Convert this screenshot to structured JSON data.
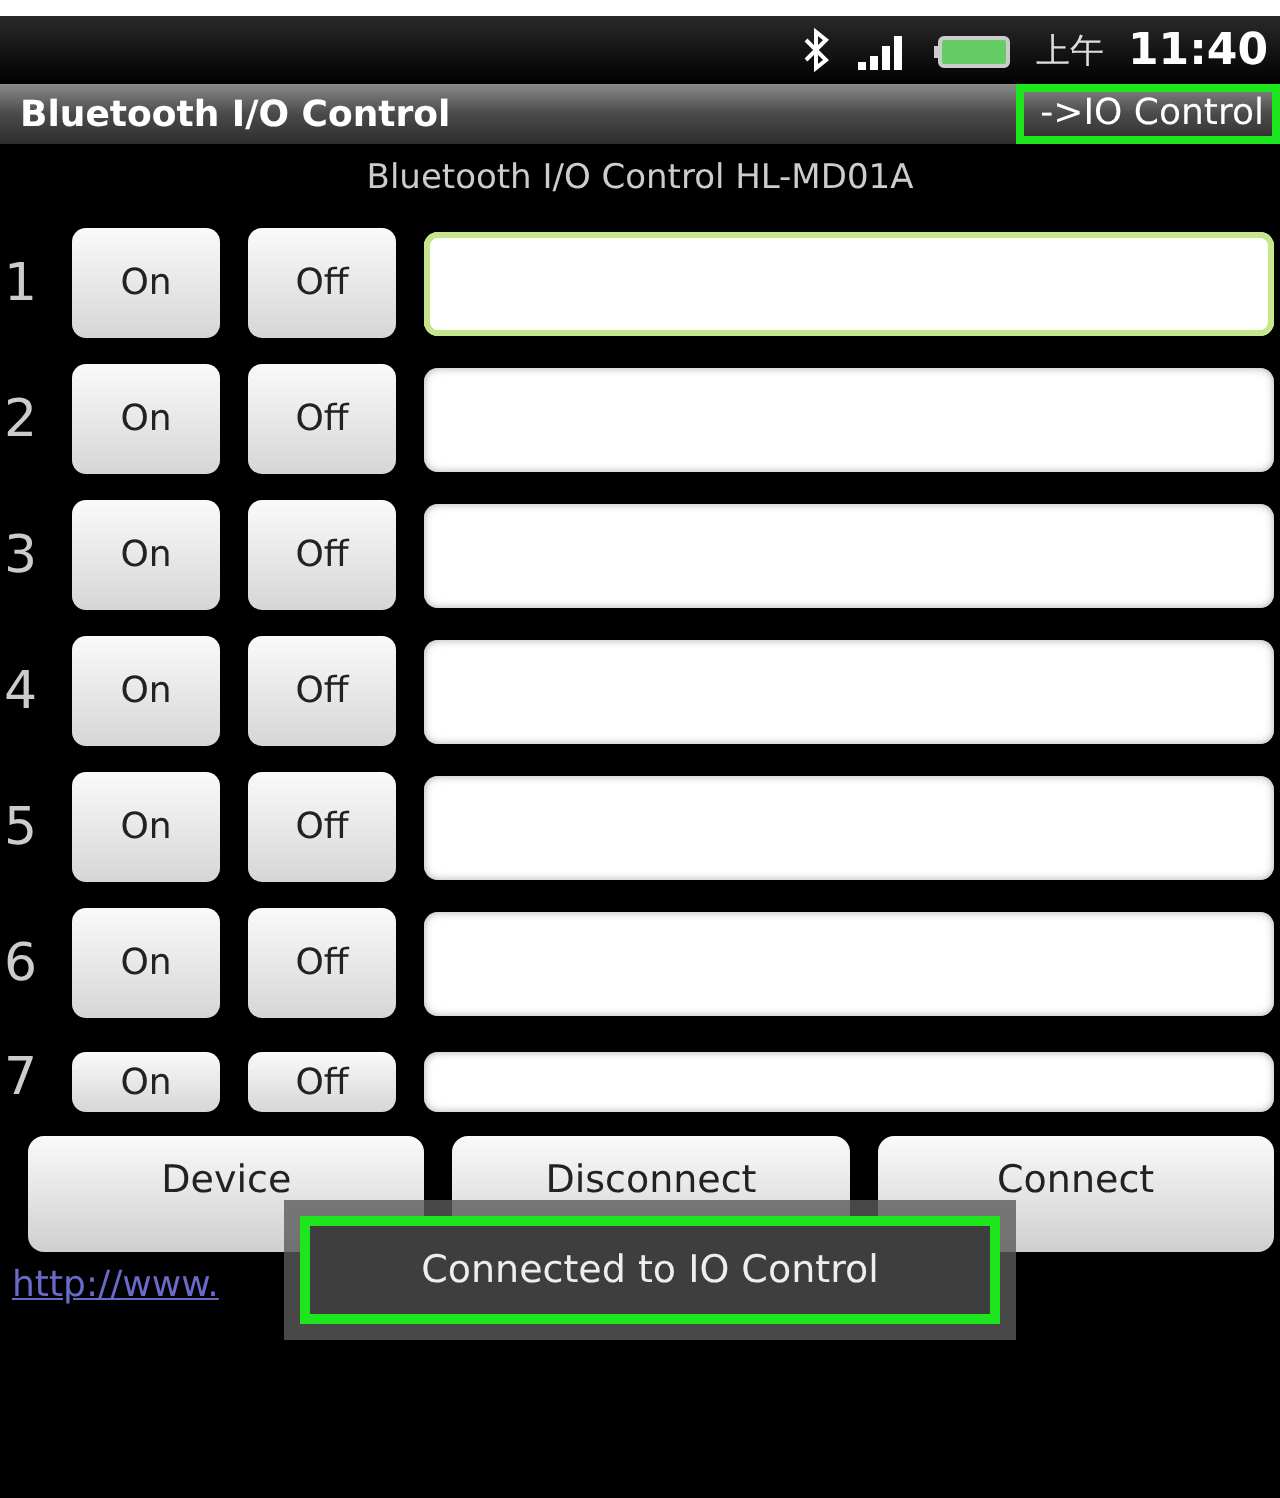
{
  "status_bar": {
    "ampm": "上午",
    "time": "11:40"
  },
  "title_bar": {
    "title": "Bluetooth I/O Control",
    "target": "->IO Control"
  },
  "subtitle": "Bluetooth I/O Control HL-MD01A",
  "channels": [
    {
      "number": "1",
      "on": "On",
      "off": "Off",
      "focused": true
    },
    {
      "number": "2",
      "on": "On",
      "off": "Off",
      "focused": false
    },
    {
      "number": "3",
      "on": "On",
      "off": "Off",
      "focused": false
    },
    {
      "number": "4",
      "on": "On",
      "off": "Off",
      "focused": false
    },
    {
      "number": "5",
      "on": "On",
      "off": "Off",
      "focused": false
    },
    {
      "number": "6",
      "on": "On",
      "off": "Off",
      "focused": false
    },
    {
      "number": "7",
      "on": "On",
      "off": "Off",
      "focused": false
    }
  ],
  "buttons": [
    "Device",
    "Disconnect",
    "Connect"
  ],
  "link": "http://www.",
  "toast": "Connected to IO Control"
}
